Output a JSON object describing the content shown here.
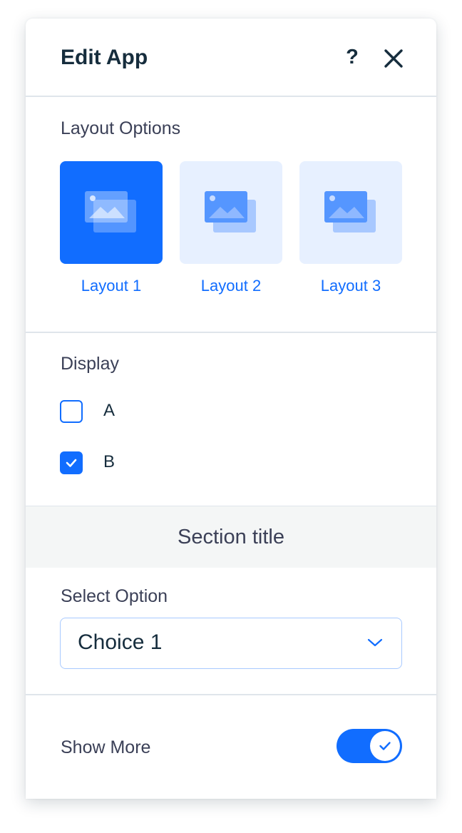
{
  "header": {
    "title": "Edit App",
    "help_label": "?"
  },
  "layout_section": {
    "label": "Layout Options",
    "options": [
      {
        "label": "Layout 1",
        "selected": true
      },
      {
        "label": "Layout 2",
        "selected": false
      },
      {
        "label": "Layout 3",
        "selected": false
      }
    ]
  },
  "display_section": {
    "label": "Display",
    "checkboxes": [
      {
        "label": "A",
        "checked": false
      },
      {
        "label": "B",
        "checked": true
      }
    ]
  },
  "section_title": "Section title",
  "select_section": {
    "label": "Select Option",
    "value": "Choice 1"
  },
  "show_more": {
    "label": "Show More",
    "enabled": true
  },
  "colors": {
    "accent": "#116dff",
    "accent_light": "#e7f0ff",
    "text_primary": "#162d3d",
    "text_secondary": "#3b4057",
    "divider": "#dfe5eb",
    "section_bg": "#f4f6f6"
  }
}
